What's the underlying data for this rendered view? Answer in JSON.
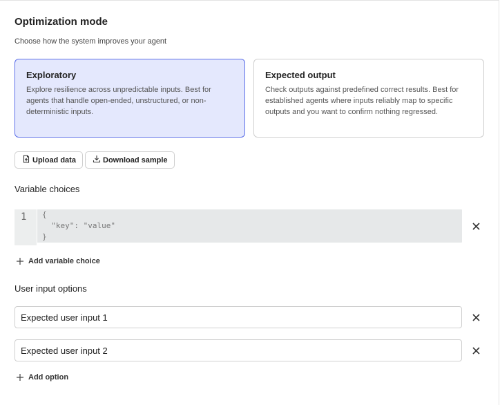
{
  "header": {
    "title": "Optimization mode",
    "subtitle": "Choose how the system improves your agent"
  },
  "modes": [
    {
      "title": "Exploratory",
      "description": "Explore resilience across unpredictable inputs. Best for agents that handle open-ended, unstructured, or non-deterministic inputs.",
      "selected": true
    },
    {
      "title": "Expected output",
      "description": "Check outputs against predefined correct results. Best for established agents where inputs reliably map to specific outputs and you want to confirm nothing regressed.",
      "selected": false
    }
  ],
  "actions": {
    "upload_label": "Upload data",
    "download_label": "Download sample"
  },
  "variables": {
    "label": "Variable choices",
    "line_number": "1",
    "code_lines": [
      "{",
      "  \"key\": \"value\"",
      "}"
    ],
    "add_label": "Add variable choice"
  },
  "user_inputs": {
    "label": "User input options",
    "items": [
      "Expected user input 1",
      "Expected user input 2"
    ],
    "add_label": "Add option"
  },
  "colors": {
    "selected_bg": "#e4e8fd",
    "selected_border": "#5b6ee8"
  }
}
